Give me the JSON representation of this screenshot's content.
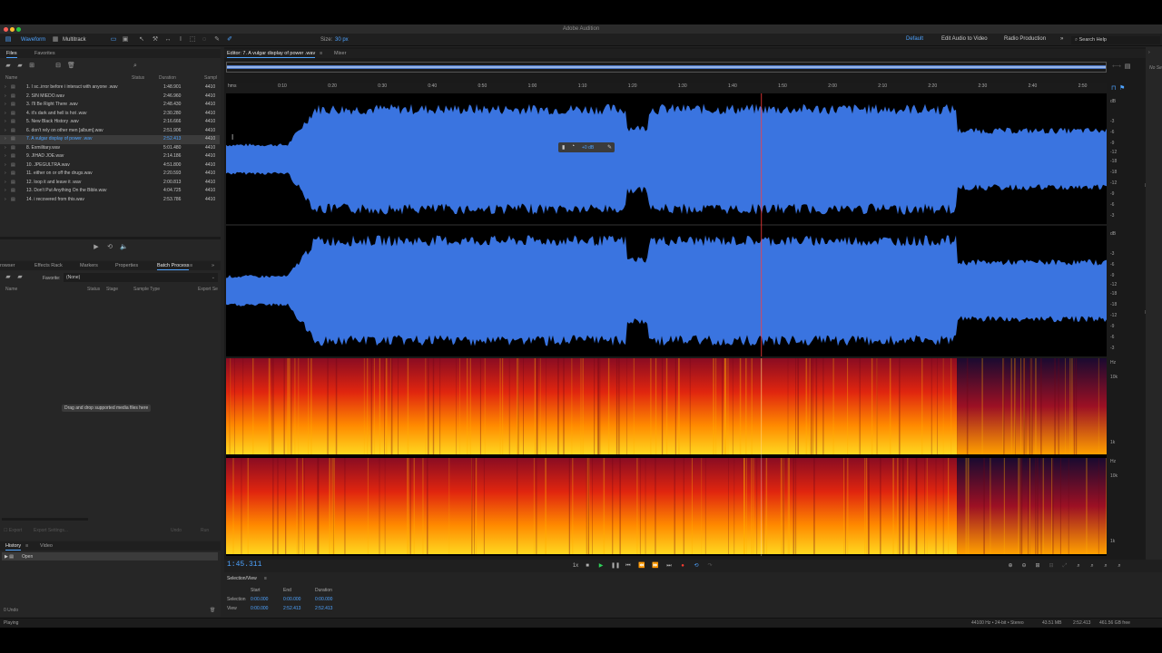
{
  "app": {
    "title": "Adobe Audition"
  },
  "toolbar": {
    "waveform": "Waveform",
    "multitrack": "Multitrack",
    "size_label": "Size:",
    "size_value": "30 px",
    "workspaces": [
      "Default",
      "Edit Audio to Video",
      "Radio Production"
    ],
    "search_placeholder": "Search Help"
  },
  "files_panel": {
    "tabs": [
      "Files",
      "Favorites"
    ],
    "columns": {
      "name": "Name",
      "status": "Status",
      "duration": "Duration",
      "sample": "Sampl"
    },
    "rows": [
      {
        "name": "1. I sc..irror before i interact with anyone .wav",
        "duration": "1:48.901",
        "sample": "4410"
      },
      {
        "name": "2. SIN MIEDO.wav",
        "duration": "2:46.960",
        "sample": "4410"
      },
      {
        "name": "3. I'll Be Right There .wav",
        "duration": "2:48.430",
        "sample": "4410"
      },
      {
        "name": "4. it's dark and hell is hot .wav",
        "duration": "2:30.280",
        "sample": "4410"
      },
      {
        "name": "5. New Black History .wav",
        "duration": "2:16.666",
        "sample": "4410"
      },
      {
        "name": "6. don't rely on other men [album].wav",
        "duration": "2:51.906",
        "sample": "4410"
      },
      {
        "name": "7. A vulgar display of power .wav",
        "duration": "2:52.413",
        "sample": "4410"
      },
      {
        "name": "8. Exmilitary.wav",
        "duration": "5:01.480",
        "sample": "4410"
      },
      {
        "name": "9. JIHAD JOE.wav",
        "duration": "2:14.186",
        "sample": "4410"
      },
      {
        "name": "10. JPEGULTRA.wav",
        "duration": "4:51.800",
        "sample": "4410"
      },
      {
        "name": "11. either on or off the drugs.wav",
        "duration": "2:20.593",
        "sample": "4410"
      },
      {
        "name": "12. loop it and leave it .wav",
        "duration": "2:00.813",
        "sample": "4410"
      },
      {
        "name": "13. Don't Put Anything On the Bible.wav",
        "duration": "4:04.725",
        "sample": "4410"
      },
      {
        "name": "14. i recovered from this.wav",
        "duration": "2:53.786",
        "sample": "4410"
      }
    ],
    "selected_index": 6
  },
  "batch_panel": {
    "tabs": [
      "rowser",
      "Effects Rack",
      "Markers",
      "Properties",
      "Batch Process"
    ],
    "favorite_label": "Favorite:",
    "favorite_value": "(None)",
    "columns": {
      "name": "Name",
      "status": "Status",
      "stage": "Stage",
      "sample_type": "Sample Type",
      "export": "Export Se"
    },
    "drop_hint": "Drag and drop supported media files here",
    "export_label": "Export",
    "export_settings": "Export Settings...",
    "undo": "Undo",
    "run": "Run"
  },
  "history_panel": {
    "tabs": [
      "History",
      "Video"
    ],
    "items": [
      "Open"
    ],
    "undo_count": "0 Undo"
  },
  "editor": {
    "tabs": [
      "Editor: 7. A vulgar display of power .wav",
      "Mixer"
    ],
    "ruler_labels": [
      "hms",
      "0:10",
      "0:20",
      "0:30",
      "0:40",
      "0:50",
      "1:00",
      "1:10",
      "1:20",
      "1:30",
      "1:40",
      "1:50",
      "2:00",
      "2:10",
      "2:20",
      "2:30",
      "2:40",
      "2:50"
    ],
    "hud_gain": "+0 dB",
    "db_labels_left": [
      "dB",
      "-3",
      "-6",
      "-9",
      "-12",
      "-18",
      "-18",
      "-12",
      "-9",
      "-6",
      "-3"
    ],
    "db_labels_right": [
      "dB",
      "-3",
      "-6",
      "-9",
      "-12",
      "-18",
      "-18",
      "-12",
      "-9",
      "-6",
      "-3"
    ],
    "hz_labels": [
      "Hz",
      "10k",
      "1k"
    ],
    "playhead_fraction": 0.608
  },
  "transport": {
    "timecode": "1:45.311",
    "speed": "1x"
  },
  "selection_view": {
    "title": "Selection/View",
    "headers": [
      "Start",
      "End",
      "Duration"
    ],
    "rows": [
      {
        "label": "Selection",
        "start": "0:00.000",
        "end": "0:00.000",
        "duration": "0:00.000"
      },
      {
        "label": "View",
        "start": "0:00.000",
        "end": "2:52.413",
        "duration": "2:52.413"
      }
    ]
  },
  "status_bar": {
    "state": "Playing",
    "format": "44100 Hz • 24-bit • Stereo",
    "size": "43.51 MB",
    "duration": "2:52.413",
    "free": "461.56 GB free"
  },
  "right_panel": {
    "text": "No Se"
  },
  "colors": {
    "accent": "#4ea3ff",
    "waveform": "#3a74e0",
    "background": "#232323"
  }
}
